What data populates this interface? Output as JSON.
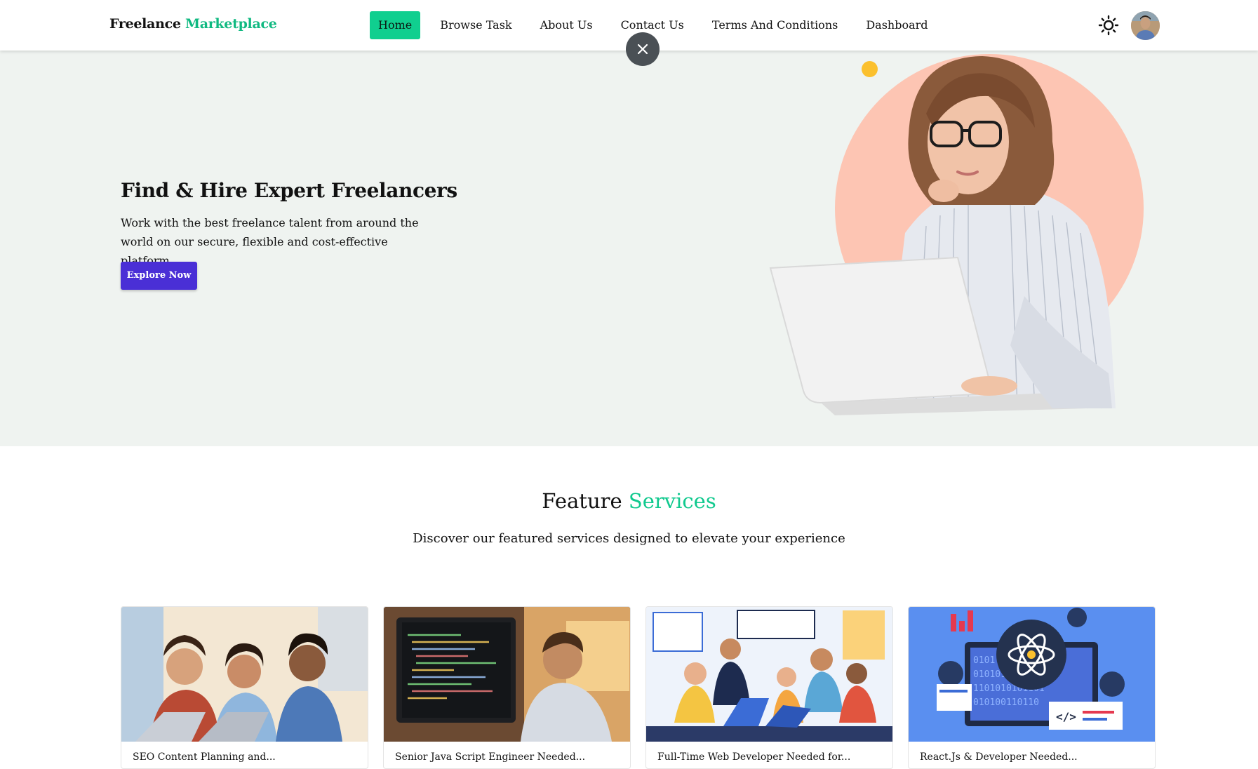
{
  "navbar": {
    "logo_text": "Freelance",
    "logo_accent": "Marketplace",
    "links": [
      "Home",
      "Browse Task",
      "About Us",
      "Contact Us",
      "Terms And Conditions",
      "Dashboard"
    ],
    "active_link": "Home"
  },
  "hero": {
    "title": "Find & Hire Expert Freelancers",
    "description": "Work with the best freelance talent from around the world on our secure, flexible and cost-effective platform.",
    "cta_label": "Explore Now"
  },
  "feature": {
    "title_plain": "Feature",
    "title_accent": "Services",
    "subtitle": "Discover our featured services designed to elevate your experience"
  },
  "cards": [
    {
      "title": "SEO Content Planning and..."
    },
    {
      "title": "Senior Java Script Engineer Needed..."
    },
    {
      "title": "Full-Time Web Developer Needed for..."
    },
    {
      "title": "React.Js & Developer Needed..."
    }
  ],
  "colors": {
    "accent_green": "#10cf8f",
    "primary_button": "#4a2fd6",
    "hero_bg": "#eff3f0"
  },
  "icons": {
    "theme_toggle": "sun-icon",
    "close": "close-icon"
  }
}
